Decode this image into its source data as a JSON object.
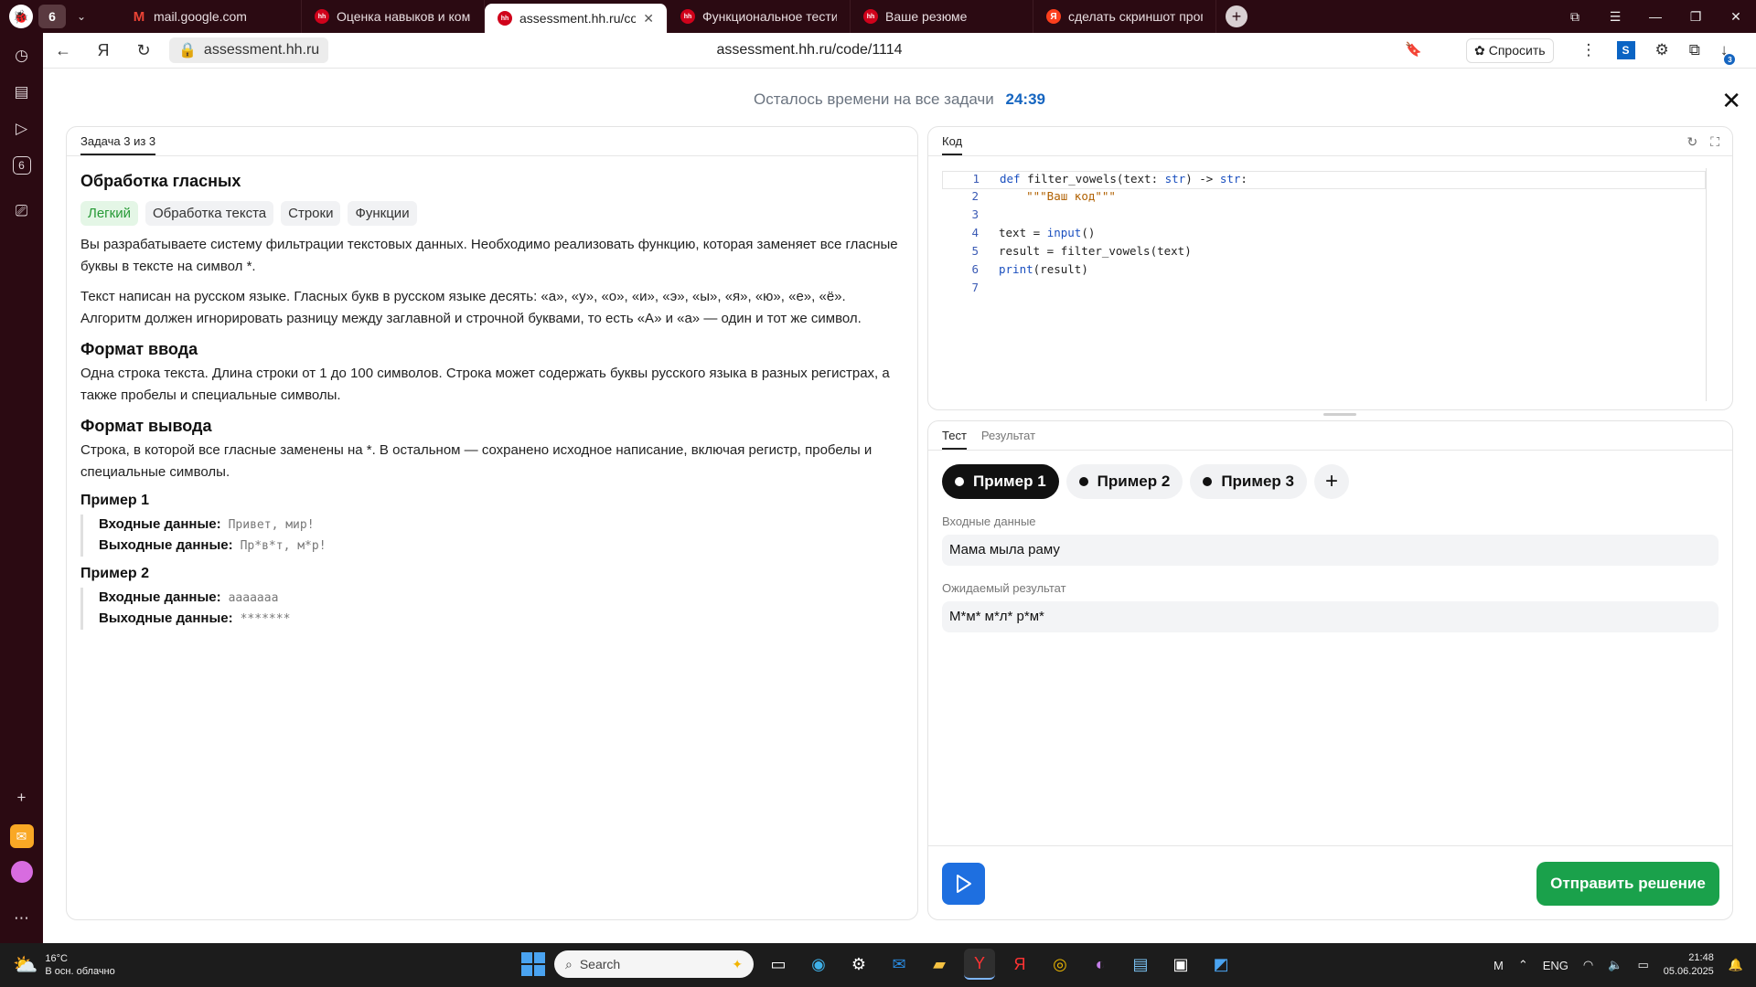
{
  "browser": {
    "tab_count": "6",
    "tabs": [
      {
        "label": "mail.google.com",
        "favicon": "gmail"
      },
      {
        "label": "Оценка навыков и компе",
        "favicon": "hh"
      },
      {
        "label": "assessment.hh.ru/code",
        "favicon": "hh"
      },
      {
        "label": "Функциональное тестиро",
        "favicon": "hh"
      },
      {
        "label": "Ваше резюме",
        "favicon": "hh"
      },
      {
        "label": "сделать скриншот програ",
        "favicon": "yandex"
      }
    ],
    "url_short": "assessment.hh.ru",
    "url_full": "assessment.hh.ru/code/1114",
    "ask_label": "Спросить",
    "downloads_badge": "3"
  },
  "timer": {
    "label": "Осталось времени на все задачи",
    "value": "24:39"
  },
  "task": {
    "tab_label": "Задача 3 из 3",
    "title": "Обработка гласных",
    "tags": [
      "Легкий",
      "Обработка текста",
      "Строки",
      "Функции"
    ],
    "description_1": "Вы разрабатываете систему фильтрации текстовых данных. Необходимо реализовать функцию, которая заменяет все гласные буквы в тексте на символ *.",
    "description_2": "Текст написан на русском языке. Гласных букв в русском языке десять: «а», «у», «о», «и», «э», «ы», «я», «ю», «е», «ё». Алгоритм должен игнорировать разницу между заглавной и строчной буквами, то есть «А» и «а» — один и тот же символ.",
    "input_format_title": "Формат ввода",
    "input_format_text": "Одна строка текста. Длина строки от 1 до 100 символов. Строка может содержать буквы русского языка в разных регистрах, а также пробелы и специальные символы.",
    "output_format_title": "Формат вывода",
    "output_format_text": "Строка, в которой все гласные заменены на *. В остальном — сохранено исходное написание, включая регистр, пробелы и специальные символы.",
    "input_label": "Входные данные:",
    "output_label": "Выходные данные:",
    "examples": [
      {
        "title": "Пример 1",
        "input": "Привет, мир!",
        "output": "Пр*в*т, м*р!"
      },
      {
        "title": "Пример 2",
        "input": "ааааааа",
        "output": "*******"
      }
    ]
  },
  "code_panel": {
    "tab_label": "Код",
    "line_numbers": [
      "1",
      "2",
      "3",
      "4",
      "5",
      "6",
      "7"
    ]
  },
  "test_panel": {
    "tabs": [
      "Тест",
      "Результат"
    ],
    "examples": [
      "Пример 1",
      "Пример 2",
      "Пример 3"
    ],
    "input_label": "Входные данные",
    "input_value": "Мама мыла раму",
    "expected_label": "Ожидаемый результат",
    "expected_value": "М*м* м*л* р*м*",
    "submit_label": "Отправить решение"
  },
  "taskbar": {
    "temperature": "16°C",
    "weather": "В осн. облачно",
    "search_placeholder": "Search",
    "language": "ENG",
    "time": "21:48",
    "date": "05.06.2025"
  }
}
